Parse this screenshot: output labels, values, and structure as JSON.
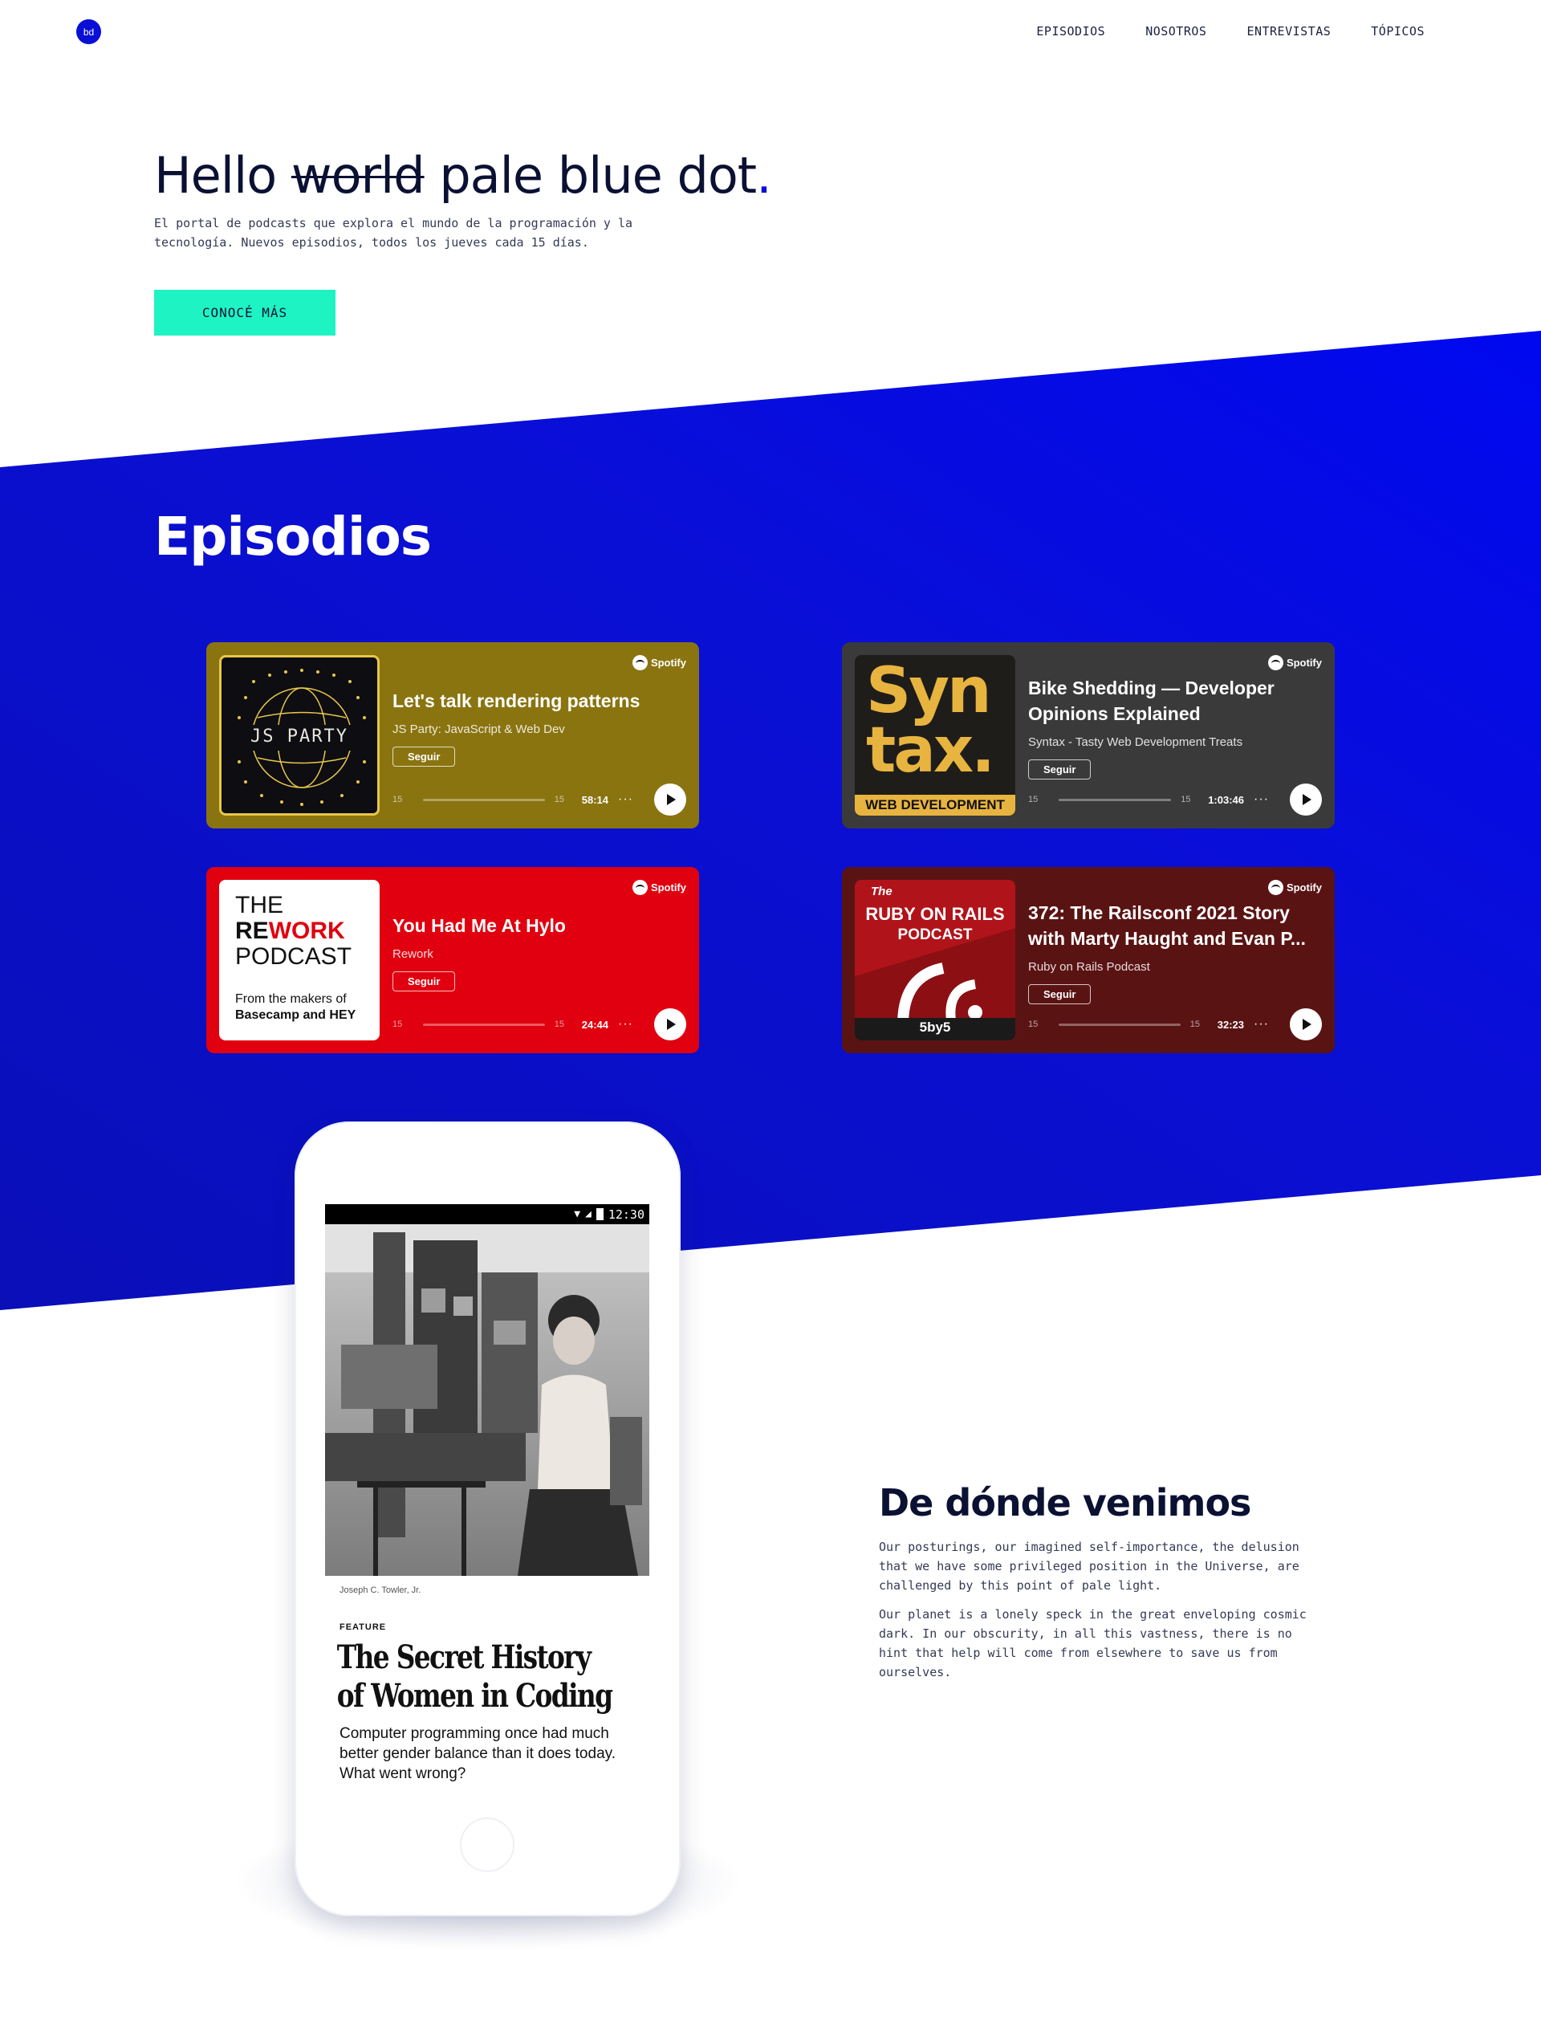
{
  "nav": {
    "logo": "bd",
    "items": [
      "EPISODIOS",
      "NOSOTROS",
      "ENTREVISTAS",
      "TÓPICOS"
    ]
  },
  "hero": {
    "title_start": "Hello",
    "title_strike": "world",
    "title_end": "pale blue dot",
    "title_dot": ".",
    "subtitle": "El portal de podcasts que explora el mundo de la programación y la tecnología. Nuevos episodios, todos los jueves cada 15 días.",
    "cta": "CONOCÉ MÁS"
  },
  "episodes": {
    "title": "Episodios",
    "provider": "Spotify",
    "follow_label": "Seguir",
    "skip_label": "15",
    "more_label": "···",
    "cards": [
      {
        "title": "Let's talk rendering patterns",
        "show": "JS Party: JavaScript & Web Dev",
        "duration": "58:14",
        "art_text": "JS PARTY",
        "color": "#8a7410"
      },
      {
        "title": "Bike Shedding — Developer Opinions Explained",
        "show": "Syntax - Tasty Web Development Treats",
        "duration": "1:03:46",
        "art_text_1": "Syn",
        "art_text_2": "tax.",
        "art_text_3": "WEB DEVELOPMENT",
        "color": "#3a3a3a"
      },
      {
        "title": "You Had Me At Hylo",
        "show": "Rework",
        "duration": "24:44",
        "art_text_1": "THE",
        "art_text_2a": "RE",
        "art_text_2b": "WORK",
        "art_text_3": "PODCAST",
        "art_text_4": "From the makers of",
        "art_text_5": "Basecamp and HEY",
        "color": "#e0000f"
      },
      {
        "title": "372: The Railsconf 2021 Story with Marty Haught and Evan P...",
        "show": "Ruby on Rails Podcast",
        "duration": "32:23",
        "art_text_1": "The",
        "art_text_2": "RUBY ON RAILS",
        "art_text_3": "PODCAST",
        "art_text_4": "5by5",
        "color": "#5a1313"
      }
    ]
  },
  "phone": {
    "time": "12:30",
    "credit": "Joseph C. Towler, Jr.",
    "kicker": "FEATURE",
    "headline_1": "The Secret History",
    "headline_2": "of Women in Coding",
    "dek": "Computer programming once had much better gender balance than it does today. What went wrong?"
  },
  "about": {
    "title": "De dónde venimos",
    "p1": "Our posturings, our imagined self-importance, the delusion that we have some privileged position in the Universe, are challenged by this point of pale light.",
    "p2": "Our planet is a lonely speck in the great enveloping cosmic dark. In our obscurity, in all this vastness, there is no hint that help will come from elsewhere to save us from ourselves."
  },
  "colors": {
    "brand_blue": "#0a0fd6",
    "cta_green": "#1ef3c3",
    "ink": "#0b1133"
  }
}
